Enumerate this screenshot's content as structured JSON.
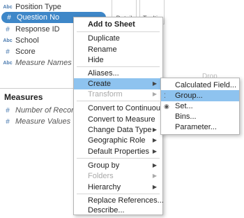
{
  "data_pane": {
    "dimensions": [
      {
        "type": "Abc",
        "name": "Position Type"
      },
      {
        "type": "#",
        "name": "Question No",
        "selected": true
      },
      {
        "type": "#",
        "name": "Response ID"
      },
      {
        "type": "Abc",
        "name": "School"
      },
      {
        "type": "#",
        "name": "Score"
      },
      {
        "type": "Abc",
        "name": "Measure Names"
      }
    ],
    "measures_title": "Measures",
    "measures": [
      {
        "type": "#",
        "name": "Number of Records"
      },
      {
        "type": "#",
        "name": "Measure Values"
      }
    ]
  },
  "marks": {
    "detail_label": "Detail",
    "tooltip_label": "Tooltip",
    "drop_hint": "Drop"
  },
  "context_menu": {
    "items": [
      {
        "label": "Add to Sheet",
        "bold": true
      },
      {
        "label": "Duplicate"
      },
      {
        "label": "Rename"
      },
      {
        "label": "Hide"
      },
      {
        "label": "Aliases..."
      },
      {
        "label": "Create",
        "submenu": true,
        "active": true
      },
      {
        "label": "Transform",
        "submenu": true,
        "disabled": true
      },
      {
        "label": "Convert to Continuous"
      },
      {
        "label": "Convert to Measure"
      },
      {
        "label": "Change Data Type",
        "submenu": true
      },
      {
        "label": "Geographic Role",
        "submenu": true
      },
      {
        "label": "Default Properties",
        "submenu": true
      },
      {
        "label": "Group by",
        "submenu": true
      },
      {
        "label": "Folders",
        "submenu": true,
        "disabled": true
      },
      {
        "label": "Hierarchy",
        "submenu": true
      },
      {
        "label": "Replace References..."
      },
      {
        "label": "Describe..."
      }
    ],
    "arrow_glyph": "▶"
  },
  "create_submenu": {
    "items": [
      {
        "label": "Calculated Field..."
      },
      {
        "label": "Group...",
        "active": true,
        "icon": "group-icon"
      },
      {
        "label": "Set...",
        "icon": "set-icon"
      },
      {
        "label": "Bins..."
      },
      {
        "label": "Parameter..."
      }
    ],
    "icon_glyphs": {
      "group": "⁚",
      "set": "◉"
    }
  }
}
